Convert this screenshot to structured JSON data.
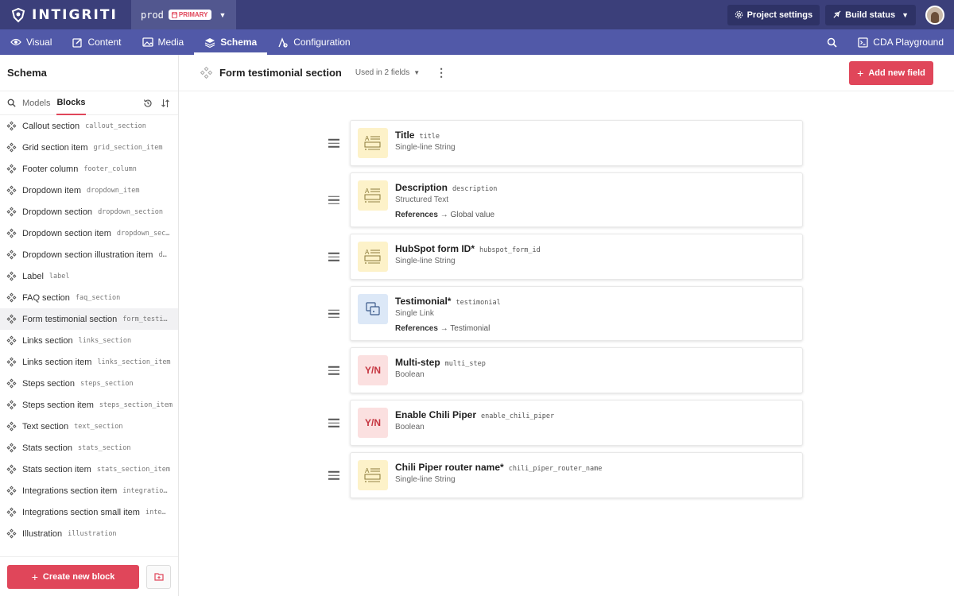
{
  "app": {
    "logo_text": "INTIGRITI",
    "environment": "prod",
    "environment_badge": "PRIMARY",
    "project_settings_label": "Project settings",
    "build_status_label": "Build status"
  },
  "nav": {
    "items": [
      {
        "label": "Visual",
        "icon": "eye-icon"
      },
      {
        "label": "Content",
        "icon": "edit-icon"
      },
      {
        "label": "Media",
        "icon": "image-icon"
      },
      {
        "label": "Schema",
        "icon": "layers-icon",
        "active": true
      },
      {
        "label": "Configuration",
        "icon": "config-icon"
      }
    ],
    "cda_label": "CDA Playground"
  },
  "sidebar": {
    "title": "Schema",
    "tabs": [
      {
        "label": "Models"
      },
      {
        "label": "Blocks",
        "active": true
      }
    ],
    "items": [
      {
        "label": "Callout section",
        "api": "callout_section"
      },
      {
        "label": "Grid section item",
        "api": "grid_section_item"
      },
      {
        "label": "Footer column",
        "api": "footer_column"
      },
      {
        "label": "Dropdown item",
        "api": "dropdown_item"
      },
      {
        "label": "Dropdown section",
        "api": "dropdown_section"
      },
      {
        "label": "Dropdown section item",
        "api": "dropdown_sec…"
      },
      {
        "label": "Dropdown section illustration item",
        "api": "d…"
      },
      {
        "label": "Label",
        "api": "label"
      },
      {
        "label": "FAQ section",
        "api": "faq_section"
      },
      {
        "label": "Form testimonial section",
        "api": "form_testi…"
      },
      {
        "label": "Links section",
        "api": "links_section"
      },
      {
        "label": "Links section item",
        "api": "links_section_item"
      },
      {
        "label": "Steps section",
        "api": "steps_section"
      },
      {
        "label": "Steps section item",
        "api": "steps_section_item"
      },
      {
        "label": "Text section",
        "api": "text_section"
      },
      {
        "label": "Stats section",
        "api": "stats_section"
      },
      {
        "label": "Stats section item",
        "api": "stats_section_item"
      },
      {
        "label": "Integrations section item",
        "api": "integratio…"
      },
      {
        "label": "Integrations section small item",
        "api": "inte…"
      },
      {
        "label": "Illustration",
        "api": "illustration"
      }
    ],
    "create_label": "Create new block"
  },
  "main": {
    "title": "Form testimonial section",
    "used_in": "Used in 2 fields",
    "add_field_label": "Add new field",
    "fields": [
      {
        "name": "Title",
        "api": "title",
        "type": "Single-line String",
        "icon": "text"
      },
      {
        "name": "Description",
        "api": "description",
        "type": "Structured Text",
        "icon": "text",
        "ref_label": "References",
        "ref_target": "→ Global value"
      },
      {
        "name": "HubSpot form ID*",
        "api": "hubspot_form_id",
        "type": "Single-line String",
        "icon": "text"
      },
      {
        "name": "Testimonial*",
        "api": "testimonial",
        "type": "Single Link",
        "icon": "link",
        "ref_label": "References",
        "ref_target": "→ Testimonial"
      },
      {
        "name": "Multi-step",
        "api": "multi_step",
        "type": "Boolean",
        "icon": "bool",
        "bool_text": "Y/N"
      },
      {
        "name": "Enable Chili Piper",
        "api": "enable_chili_piper",
        "type": "Boolean",
        "icon": "bool",
        "bool_text": "Y/N"
      },
      {
        "name": "Chili Piper router name*",
        "api": "chili_piper_router_name",
        "type": "Single-line String",
        "icon": "text"
      }
    ]
  },
  "colors": {
    "topbar": "#3b3f7a",
    "navbar": "#5159a8",
    "accent": "#e0465a"
  }
}
